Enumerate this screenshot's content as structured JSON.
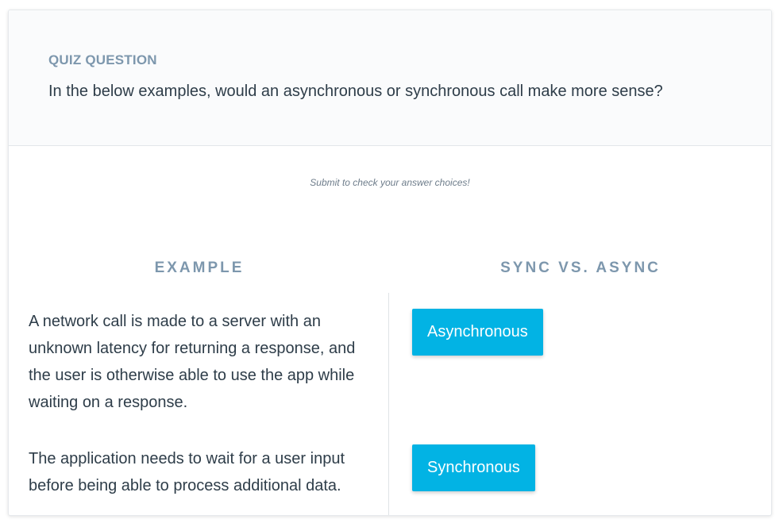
{
  "quiz": {
    "label": "QUIZ QUESTION",
    "question": "In the below examples, would an asynchronous or synchronous call make more sense?"
  },
  "hint": "Submit to check your answer choices!",
  "columns": {
    "example": "EXAMPLE",
    "answer": "SYNC VS. ASYNC"
  },
  "rows": [
    {
      "example": "A network call is made to a server with an unknown latency for returning a response, and the user is otherwise able to use the app while waiting on a response.",
      "answer": "Asynchronous"
    },
    {
      "example": "The application needs to wait for a user input before being able to process additional data.",
      "answer": "Synchronous"
    }
  ],
  "colors": {
    "accent": "#02b3e4",
    "label": "#7d97ad",
    "text": "#2e3d49"
  }
}
